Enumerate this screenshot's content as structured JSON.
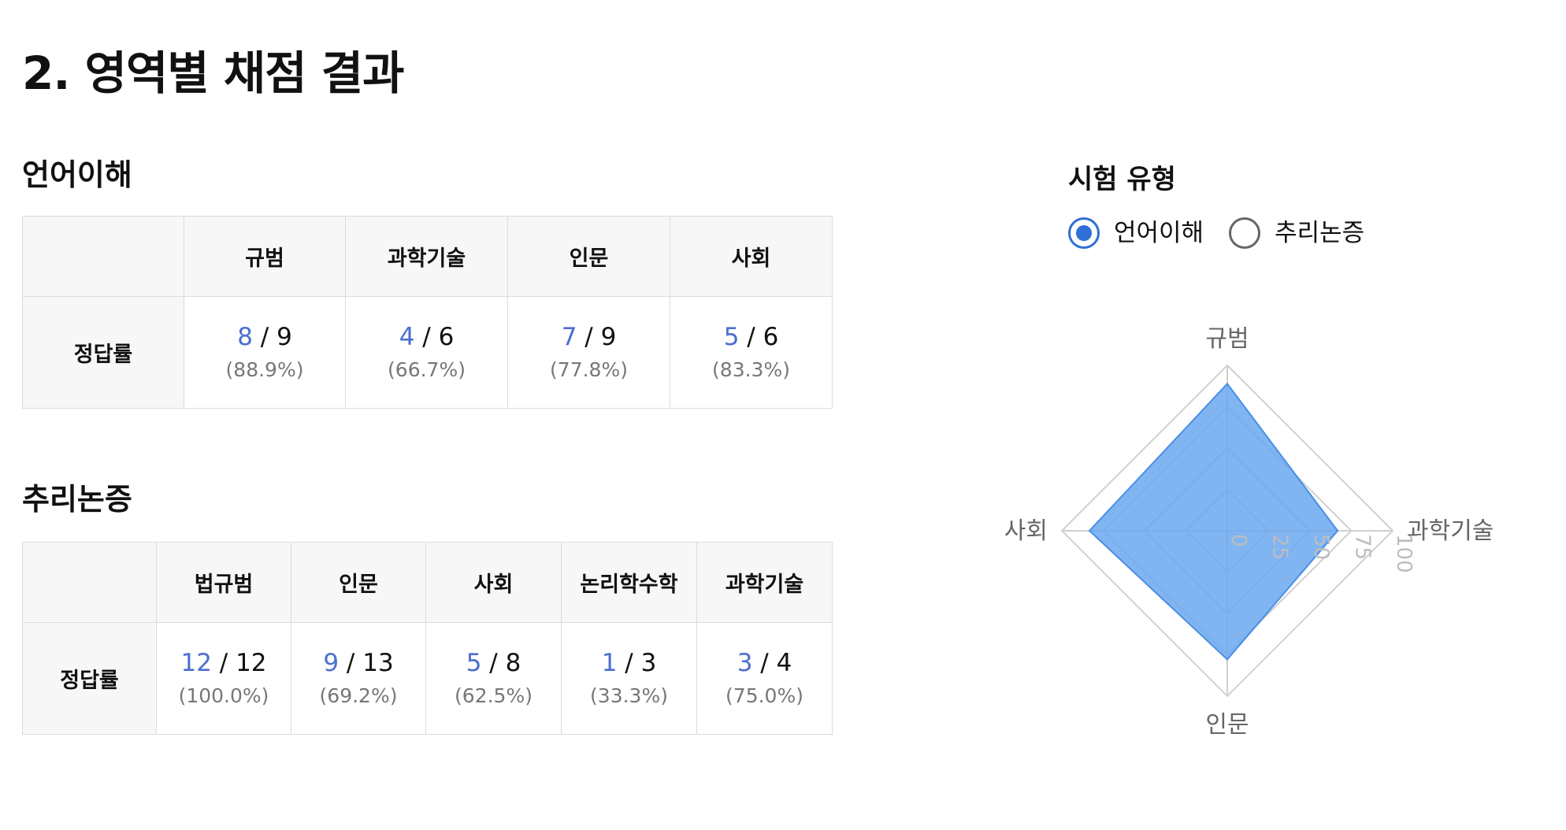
{
  "page_title": "2. 영역별 채점 결과",
  "sections": [
    {
      "title": "언어이해",
      "row_label": "정답률",
      "columns": [
        {
          "label": "규범",
          "correct": "8",
          "total": "9",
          "percent": "(88.9%)"
        },
        {
          "label": "과학기술",
          "correct": "4",
          "total": "6",
          "percent": "(66.7%)"
        },
        {
          "label": "인문",
          "correct": "7",
          "total": "9",
          "percent": "(77.8%)"
        },
        {
          "label": "사회",
          "correct": "5",
          "total": "6",
          "percent": "(83.3%)"
        }
      ]
    },
    {
      "title": "추리논증",
      "row_label": "정답률",
      "columns": [
        {
          "label": "법규범",
          "correct": "12",
          "total": "12",
          "percent": "(100.0%)"
        },
        {
          "label": "인문",
          "correct": "9",
          "total": "13",
          "percent": "(69.2%)"
        },
        {
          "label": "사회",
          "correct": "5",
          "total": "8",
          "percent": "(62.5%)"
        },
        {
          "label": "논리학수학",
          "correct": "1",
          "total": "3",
          "percent": "(33.3%)"
        },
        {
          "label": "과학기술",
          "correct": "3",
          "total": "4",
          "percent": "(75.0%)"
        }
      ]
    }
  ],
  "exam_type": {
    "title": "시험 유형",
    "options": [
      {
        "label": "언어이해",
        "checked": true
      },
      {
        "label": "추리논증",
        "checked": false
      }
    ]
  },
  "colors": {
    "accent": "#2f6fd6",
    "number": "#4a6fd0",
    "radar_fill": "#6aa8f0",
    "radar_stroke": "#4a8ee6"
  },
  "chart_data": {
    "type": "radar",
    "categories": [
      "규범",
      "과학기술",
      "인문",
      "사회"
    ],
    "values": [
      88.9,
      66.7,
      77.8,
      83.3
    ],
    "scale_ticks": [
      "0",
      "25",
      "50",
      "75",
      "100"
    ],
    "range": [
      0,
      100
    ],
    "grid": true
  }
}
